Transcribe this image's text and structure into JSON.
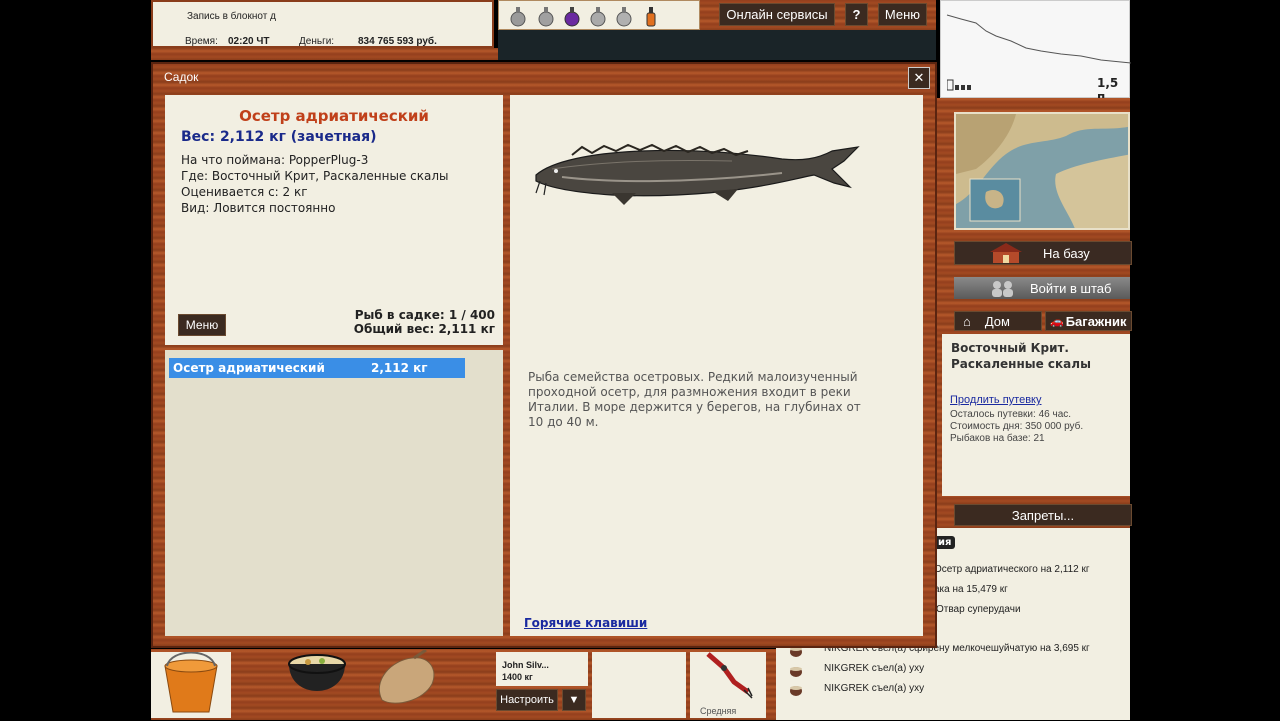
{
  "top_info": {
    "notebook": "Запись в блокнот д",
    "time_label": "Время:",
    "time_value": "02:20 ЧТ",
    "money_label": "Деньги:",
    "money_value": "834 765 593 руб."
  },
  "top_bar": {
    "online_services": "Онлайн сервисы",
    "help": "?",
    "menu": "Меню"
  },
  "map_mini": {
    "depth_reading": "1,5 п"
  },
  "window": {
    "title": "Садок",
    "close": "✕"
  },
  "fish": {
    "name": "Осетр адриатический",
    "weight_line": "Вес: 2,112 кг (зачетная)",
    "caught_on": "На что поймана: PopperPlug-3",
    "where": "Где: Восточный Крит, Раскаленные скалы",
    "rated_from": "Оценивается с: 2 кг",
    "kind": "Вид: Ловится постоянно",
    "description": "Рыба семейства осетровых. Редкий малоизученный проходной осетр, для размножения входит в реки Италии. В море держится у берегов, на глубинах от 10 до 40 м."
  },
  "keepnet": {
    "menu_button": "Меню",
    "count_line": "Рыб в садке: 1 / 400",
    "total_weight_line": "Общий вес: 2,111 кг",
    "rows": [
      {
        "name": "Осетр адриатический",
        "weight": "2,112 кг"
      }
    ]
  },
  "hotkeys_link": "Горячие клавиши",
  "right_panel": {
    "to_base": "На базу",
    "to_hq": "Войти в штаб",
    "home_tab": "Дом",
    "trunk_tab": "Багажник",
    "location_line1": "Восточный Крит.",
    "location_line2": "Раскаленные скалы",
    "extend_link": "Продлить путевку",
    "remaining": "Осталось путевки: 46 час.",
    "daily_cost": "Стоимость дня: 350 000 руб.",
    "fishers": "Рыбаков на базе: 21",
    "restrictions": "Запреты..."
  },
  "events": {
    "tab_fragment": "ия",
    "items": [
      "Осетр адриатического на 2,112 кг",
      "ака на 15,479 кг",
      "Отвар суперудачи",
      "NIKGREK съел(а) сфирену мелкочешуйчатую на 3,695 кг",
      "NIKGREK съел(а) уху",
      "NIKGREK съел(а) уху"
    ]
  },
  "bottom": {
    "player_name": "John Silv...",
    "player_weight": "1400 кг",
    "configure": "Настроить",
    "dropdown_arrow": "▼",
    "medium_label": "Средняя"
  },
  "colors": {
    "fish_name": "#c0401a",
    "weight_line": "#1a2a8a",
    "selection": "#3a8ee6",
    "link": "#1a2aa0"
  },
  "icons": [
    "potion-icon",
    "bucket-icon",
    "cauldron-icon",
    "sack-icon",
    "house-icon",
    "people-icon",
    "car-icon",
    "close-icon",
    "bowl-icon",
    "lure-icon"
  ]
}
